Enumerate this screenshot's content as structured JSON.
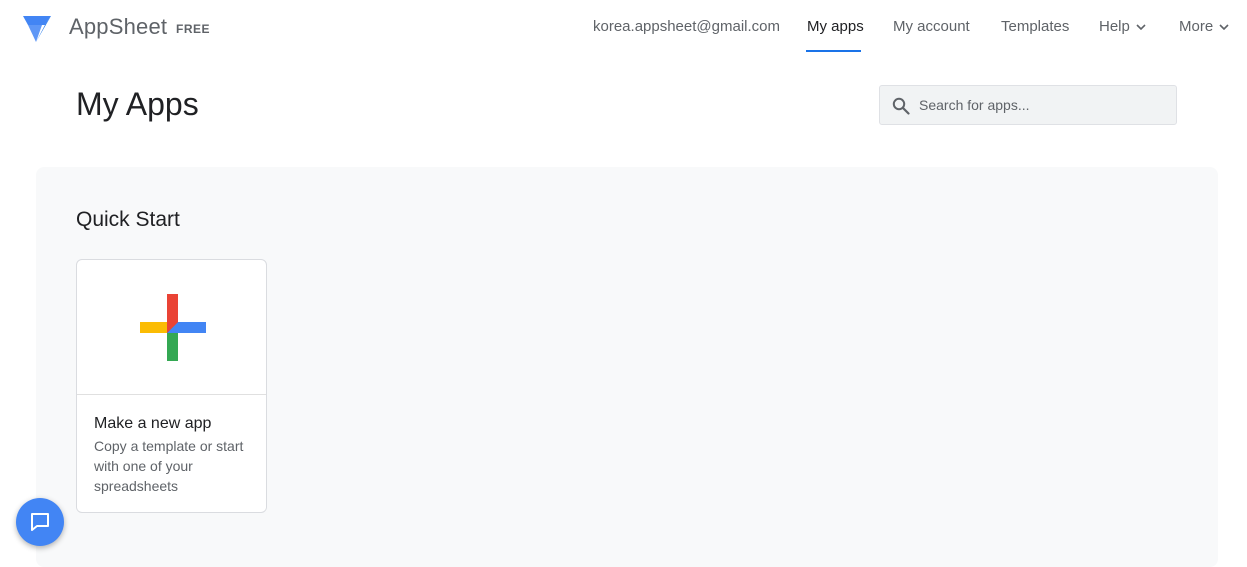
{
  "brand": {
    "name": "AppSheet",
    "plan": "FREE",
    "logo": "appsheet-logo-icon"
  },
  "nav": {
    "email": "korea.appsheet@gmail.com",
    "items": [
      {
        "label": "My apps",
        "active": true
      },
      {
        "label": "My account"
      },
      {
        "label": "Templates"
      },
      {
        "label": "Help",
        "dropdown": true
      },
      {
        "label": "More",
        "dropdown": true
      }
    ]
  },
  "page": {
    "title": "My Apps"
  },
  "search": {
    "placeholder": "Search for apps...",
    "value": "",
    "icon": "search-icon"
  },
  "quickstart": {
    "title": "Quick Start",
    "card": {
      "title": "Make a new app",
      "description": "Copy a template or start with one of your spreadsheets",
      "icon": "plus-icon"
    }
  },
  "colors": {
    "accent": "#1a73e8",
    "plus_red": "#ea4335",
    "plus_blue": "#4285f4",
    "plus_yellow": "#fbbc04",
    "plus_green": "#34a853",
    "panel_bg": "#f8f9fa"
  },
  "fab": {
    "icon": "chat-icon"
  }
}
